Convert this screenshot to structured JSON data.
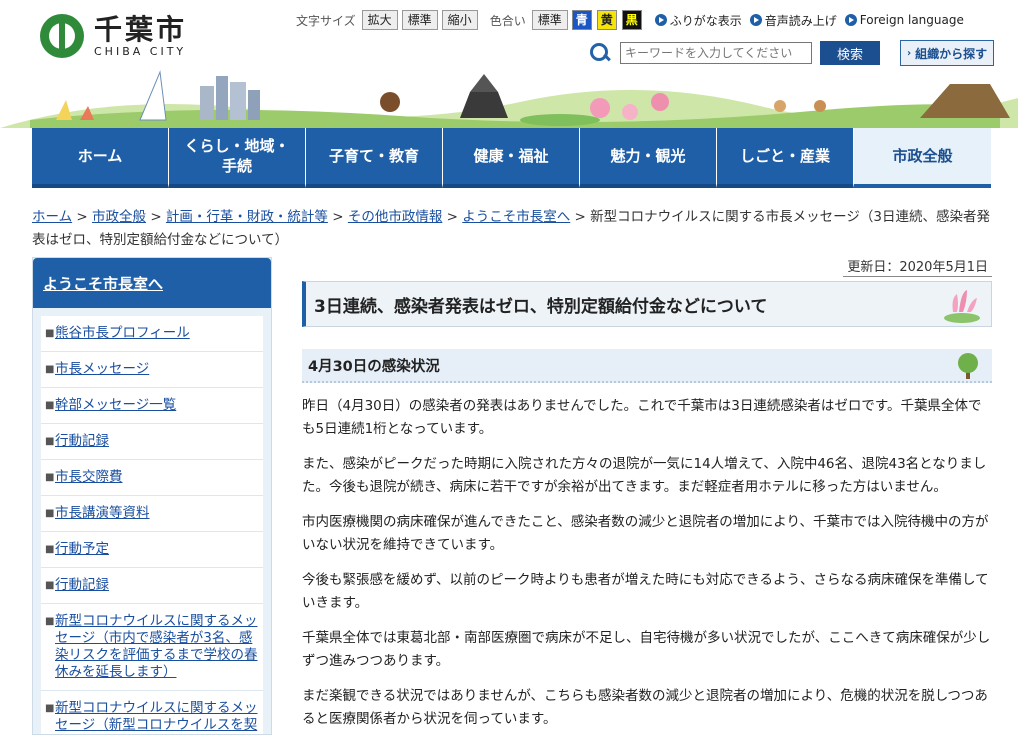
{
  "header": {
    "logo_jp": "千葉市",
    "logo_en": "CHIBA CITY",
    "font_size_label": "文字サイズ",
    "font_size_buttons": [
      "拡大",
      "標準",
      "縮小"
    ],
    "color_label": "色合い",
    "color_standard": "標準",
    "color_buttons": [
      "青",
      "黄",
      "黒"
    ],
    "links": [
      "ふりがな表示",
      "音声読み上げ",
      "Foreign language"
    ],
    "search_placeholder": "キーワードを入力してください",
    "search_button": "検索",
    "org_button": "組織から探す"
  },
  "nav": [
    {
      "label": "ホーム"
    },
    {
      "label": "くらし・地域・\n手続"
    },
    {
      "label": "子育て・教育"
    },
    {
      "label": "健康・福祉"
    },
    {
      "label": "魅力・観光"
    },
    {
      "label": "しごと・産業"
    },
    {
      "label": "市政全般"
    }
  ],
  "breadcrumb": {
    "links": [
      "ホーム",
      "市政全般",
      "計画・行革・財政・統計等",
      "その他市政情報",
      "ようこそ市長室へ"
    ],
    "separator": ">",
    "current": "新型コロナウイルスに関する市長メッセージ（3日連続、感染者発表はゼロ、特別定額給付金などについて）"
  },
  "sidebar": {
    "heading": "ようこそ市長室へ",
    "items": [
      "熊谷市長プロフィール",
      "市長メッセージ",
      "幹部メッセージ一覧",
      "行動記録",
      "市長交際費",
      "市長講演等資料",
      "行動予定",
      "行動記録",
      "新型コロナウイルスに関するメッセージ（市内で感染者が3名、感染リスクを評価するまで学校の春休みを延長します）",
      "新型コロナウイルスに関するメッセージ（新型コロナウイルスを契機に、千葉市を変革しま"
    ]
  },
  "main": {
    "update": "更新日：2020年5月1日",
    "title": "3日連続、感染者発表はゼロ、特別定額給付金などについて",
    "section_heading": "4月30日の感染状況",
    "paragraphs": [
      "昨日（4月30日）の感染者の発表はありませんでした。これで千葉市は3日連続感染者はゼロです。千葉県全体でも5日連続1桁となっています。",
      "また、感染がピークだった時期に入院された方々の退院が一気に14人増えて、入院中46名、退院43名となりました。今後も退院が続き、病床に若干ですが余裕が出てきます。まだ軽症者用ホテルに移った方はいません。",
      "市内医療機関の病床確保が進んできたこと、感染者数の減少と退院者の増加により、千葉市では入院待機中の方がいない状況を維持できています。",
      "今後も緊張感を緩めず、以前のピーク時よりも患者が増えた時にも対応できるよう、さらなる病床確保を準備していきます。",
      "千葉県全体では東葛北部・南部医療圏で病床が不足し、自宅待機が多い状況でしたが、ここへきて病床確保が少しずつ進みつつあります。",
      "まだ楽観できる状況ではありませんが、こちらも感染者数の減少と退院者の増加により、危機的状況を脱しつつあると医療関係者から状況を伺っています。"
    ]
  },
  "colors": {
    "primary": "#1f5fa8",
    "link": "#1a4fa0",
    "logo_green": "#2f8a3a"
  }
}
